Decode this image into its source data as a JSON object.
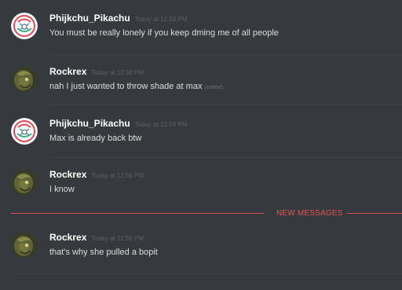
{
  "channel_messages": [
    {
      "author": "Phijkchu_Pikachu",
      "timestamp": "Today at 12:58 PM",
      "text": "You must be really lonely if you keep dming me of all people",
      "avatar_icon": "pokeball-avatar"
    },
    {
      "author": "Rockrex",
      "timestamp": "Today at 12:58 PM",
      "text": "nah I just wanted to throw shade at max",
      "edited": "(edited)",
      "avatar_icon": "rockrex-avatar"
    },
    {
      "author": "Phijkchu_Pikachu",
      "timestamp": "Today at 12:58 PM",
      "text": "Max is already back btw",
      "avatar_icon": "pokeball-avatar"
    },
    {
      "author": "Rockrex",
      "timestamp": "Today at 12:58 PM",
      "text": "I know",
      "avatar_icon": "rockrex-avatar"
    },
    {
      "author": "Rockrex",
      "timestamp": "Today at 12:58 PM",
      "text": "that's why she pulled a bopit",
      "avatar_icon": "rockrex-avatar"
    }
  ],
  "new_messages_divider": {
    "label": "NEW MESSAGES",
    "color": "#d64b4b"
  },
  "colors": {
    "background": "#36393e",
    "author": "#ffffff",
    "timestamp": "#5d6066",
    "message_text": "#dcddde",
    "separator": "#3f4247"
  }
}
